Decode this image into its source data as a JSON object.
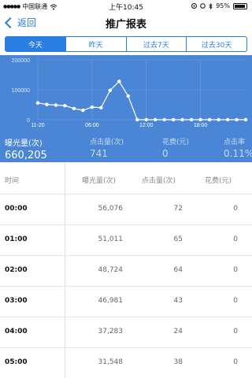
{
  "status": {
    "carrier": "中国联通",
    "time": "上午10:45",
    "battery": "95%"
  },
  "nav": {
    "back": "返回",
    "title": "推广报表"
  },
  "tabs": [
    {
      "label": "今天",
      "active": true
    },
    {
      "label": "昨天",
      "active": false
    },
    {
      "label": "过去7天",
      "active": false
    },
    {
      "label": "过去30天",
      "active": false
    }
  ],
  "chart_data": {
    "type": "line",
    "y_ticks": [
      "200000",
      "100000",
      "0"
    ],
    "ylim": [
      0,
      200000
    ],
    "x_tick_labels": [
      "11-20",
      "06:00",
      "12:00",
      "18:00"
    ],
    "x_tick_index": [
      0,
      6,
      12,
      18
    ],
    "values": [
      56076,
      51011,
      48724,
      46981,
      37283,
      31548,
      42000,
      40000,
      98000,
      128000,
      79000,
      0,
      0,
      0,
      0,
      0,
      0,
      0,
      0,
      0,
      0,
      0,
      0,
      0
    ],
    "colors": {
      "background": "#4a85d6",
      "line": "#ffffff",
      "grid": "#6f9de0"
    }
  },
  "stats": [
    {
      "label": "曝光量(次)",
      "value": "660,205"
    },
    {
      "label": "点击量(次)",
      "value": "741"
    },
    {
      "label": "花费(元)",
      "value": "0"
    },
    {
      "label": "点击率",
      "value": "0.11%"
    }
  ],
  "table": {
    "headers": [
      "时间",
      "曝光量(次)",
      "点击量(次)",
      "花费(元)"
    ],
    "rows": [
      {
        "time": "00:00",
        "impressions": "56,076",
        "clicks": "72",
        "cost": "0"
      },
      {
        "time": "01:00",
        "impressions": "51,011",
        "clicks": "65",
        "cost": "0"
      },
      {
        "time": "02:00",
        "impressions": "48,724",
        "clicks": "64",
        "cost": "0"
      },
      {
        "time": "03:00",
        "impressions": "46,981",
        "clicks": "43",
        "cost": "0"
      },
      {
        "time": "04:00",
        "impressions": "37,283",
        "clicks": "24",
        "cost": "0"
      },
      {
        "time": "05:00",
        "impressions": "31,548",
        "clicks": "38",
        "cost": "0"
      }
    ]
  }
}
